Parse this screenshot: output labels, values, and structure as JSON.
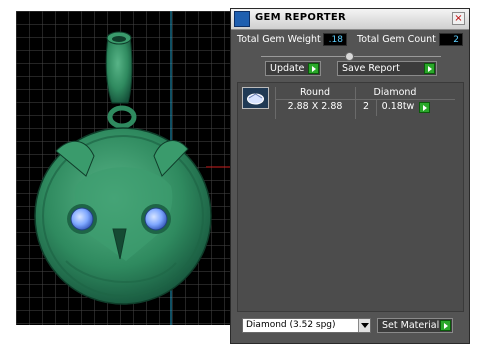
{
  "window": {
    "title": "GEM REPORTER",
    "close_glyph": "×"
  },
  "summary": {
    "weight_label": "Total Gem Weight",
    "weight_value": ".18",
    "count_label": "Total Gem Count",
    "count_value": "2"
  },
  "slider": {
    "level": 0.5
  },
  "buttons": {
    "update_label": "Update",
    "save_report_label": "Save Report",
    "set_material_label": "Set Material"
  },
  "gem_table": {
    "shape_header": "Round",
    "material_header": "Diamond",
    "size": "2.88 X 2.88",
    "count": "2",
    "weight": "0.18tw"
  },
  "material_select": {
    "value": "Diamond    (3.52 spg)"
  },
  "colors": {
    "model": "#2f8a5f",
    "grid": "#4a4a4a",
    "axis_x": "#cc1f1f",
    "axis_y": "#1fa0c8",
    "gem": "#7fa8ff",
    "accent_go": "#2aa82a",
    "value_text": "#5fd0ff"
  }
}
